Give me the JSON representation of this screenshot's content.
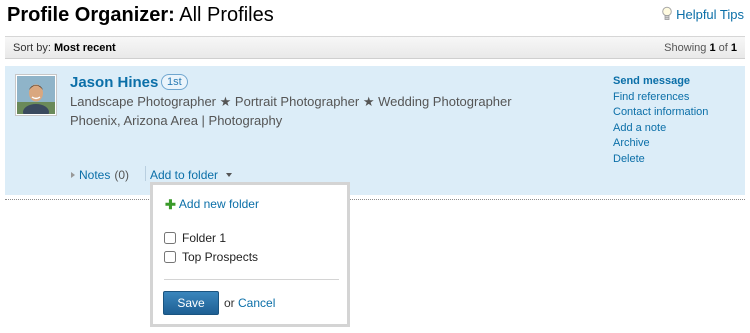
{
  "header": {
    "title_bold": "Profile Organizer:",
    "title_rest": "All Profiles",
    "help_label": "Helpful Tips",
    "help_icon": "lightbulb-icon"
  },
  "sortbar": {
    "sort_label": "Sort by:",
    "sort_value": "Most recent",
    "showing_prefix": "Showing",
    "showing_current": "1",
    "showing_of": "of",
    "showing_total": "1"
  },
  "profile": {
    "name": "Jason Hines",
    "degree": "1st",
    "headline_parts": [
      "Landscape Photographer",
      "Portrait Photographer",
      "Wedding Photographer"
    ],
    "headline_separator": "★",
    "location": "Phoenix, Arizona Area | Photography",
    "notes_label": "Notes",
    "notes_count": "(0)",
    "add_to_folder_label": "Add to folder"
  },
  "actions": [
    "Send message",
    "Find references",
    "Contact information",
    "Add a note",
    "Archive",
    "Delete"
  ],
  "folder_dropdown": {
    "add_new_label": "Add new folder",
    "folders": [
      {
        "label": "Folder 1",
        "checked": false
      },
      {
        "label": "Top Prospects",
        "checked": false
      }
    ],
    "save_label": "Save",
    "or_label": "or",
    "cancel_label": "Cancel"
  },
  "colors": {
    "link": "#0b6fa8",
    "profile_bg": "#dcedf8",
    "save_button": "#2a72a8"
  }
}
